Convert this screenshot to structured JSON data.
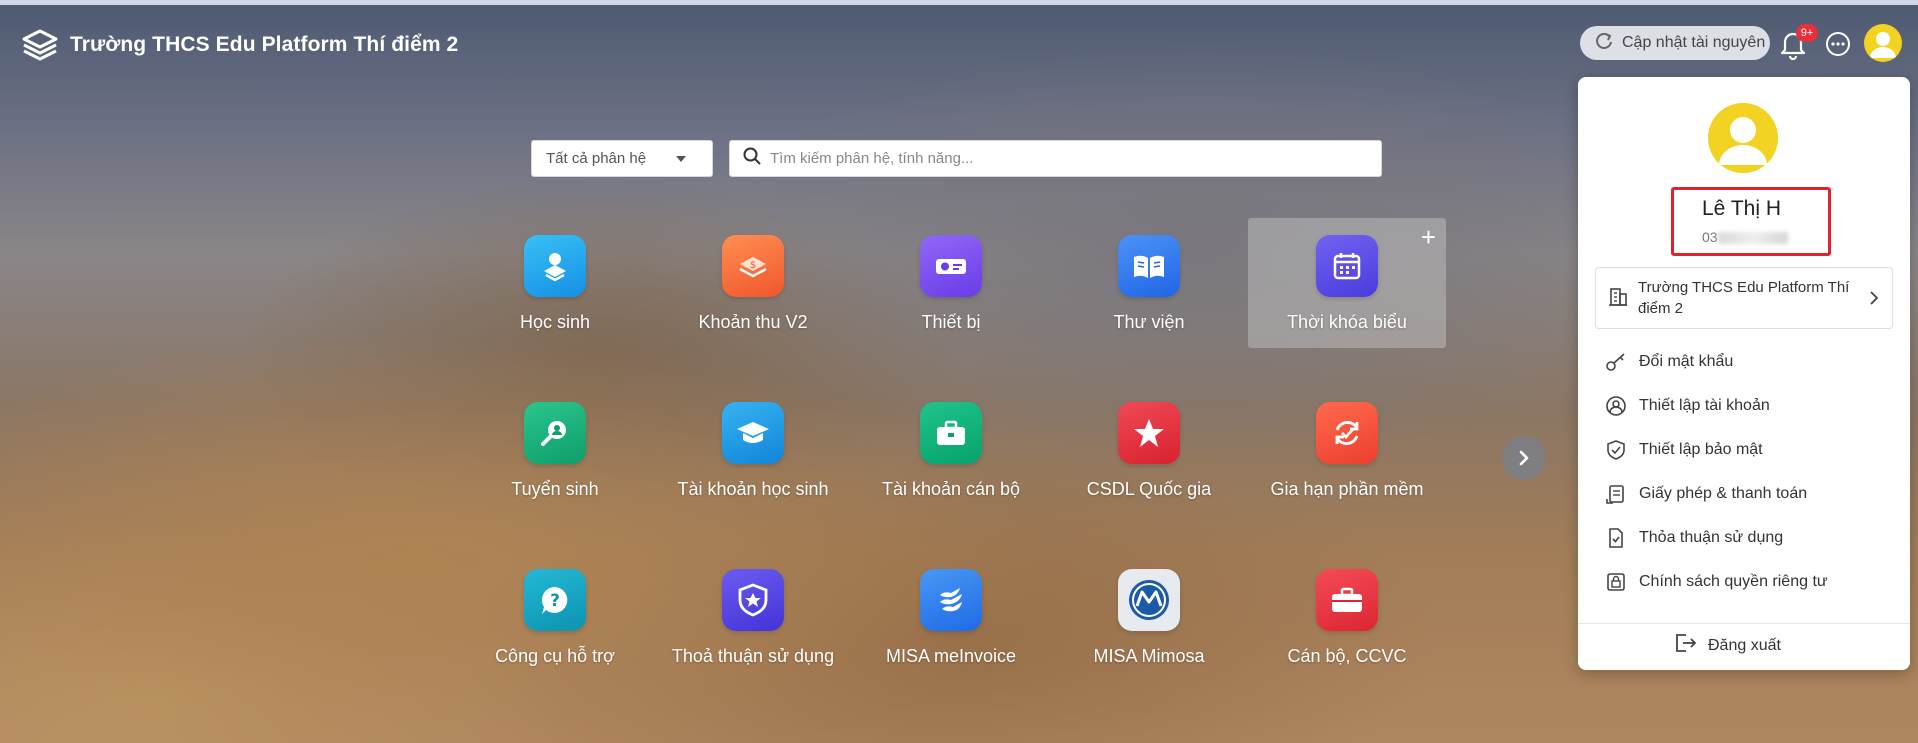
{
  "header": {
    "app_title": "Trường THCS Edu Platform Thí điểm 2",
    "update_button": "Cập nhật tài nguyên",
    "notification_badge": "9+"
  },
  "search": {
    "module_filter": "Tất cả phân hệ",
    "placeholder": "Tìm kiếm phân hệ, tính năng..."
  },
  "tiles": [
    {
      "label": "Học sinh",
      "icon": "student-icon",
      "color": "#22a7ee"
    },
    {
      "label": "Khoản thu V2",
      "icon": "fee-icon",
      "color": "#f5733b"
    },
    {
      "label": "Thiết bị",
      "icon": "projector-icon",
      "color": "#7a4df0"
    },
    {
      "label": "Thư viện",
      "icon": "book-icon",
      "color": "#2f7df1"
    },
    {
      "label": "Thời khóa biểu",
      "icon": "calendar-icon",
      "color": "#5b4ee8"
    },
    {
      "label": "Tuyển sinh",
      "icon": "admission-icon",
      "color": "#18b07b"
    },
    {
      "label": "Tài khoản học sinh",
      "icon": "graduation-cap-icon",
      "color": "#1f9ee8"
    },
    {
      "label": "Tài khoản cán bộ",
      "icon": "briefcase-icon",
      "color": "#14b57a"
    },
    {
      "label": "CSDL Quốc gia",
      "icon": "star-icon",
      "color": "#ea3341"
    },
    {
      "label": "Gia hạn phần mềm",
      "icon": "renew-icon",
      "color": "#f4503c"
    },
    {
      "label": "Công cụ hỗ trợ",
      "icon": "help-icon",
      "color": "#15a6c3"
    },
    {
      "label": "Thoả thuận sử dụng",
      "icon": "shield-star-icon",
      "color": "#5a49e2"
    },
    {
      "label": "MISA meInvoice",
      "icon": "meinvoice-icon",
      "color": "#2f83ee"
    },
    {
      "label": "MISA Mimosa",
      "icon": "mimosa-icon",
      "color": "#e8ebef"
    },
    {
      "label": "Cán bộ, CCVC",
      "icon": "staff-bag-icon",
      "color": "#ea3341"
    }
  ],
  "profile": {
    "name": "Lê Thị H",
    "phone_visible": "03",
    "school": "Trường THCS Edu Platform Thí điểm 2",
    "menu": [
      {
        "label": "Đổi mật khẩu",
        "icon": "key-icon"
      },
      {
        "label": "Thiết lập tài khoản",
        "icon": "user-circle-icon"
      },
      {
        "label": "Thiết lập bảo mật",
        "icon": "shield-check-icon"
      },
      {
        "label": "Giấy phép & thanh toán",
        "icon": "license-icon"
      },
      {
        "label": "Thỏa thuận sử dụng",
        "icon": "document-check-icon"
      },
      {
        "label": "Chính sách quyền riêng tư",
        "icon": "lock-icon"
      }
    ],
    "logout": "Đăng xuất"
  }
}
